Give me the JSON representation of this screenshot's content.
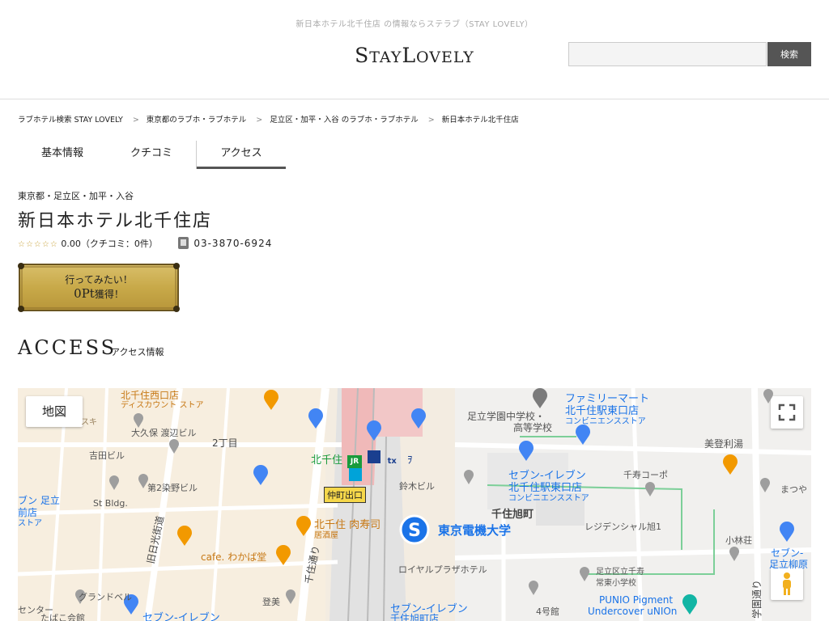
{
  "header": {
    "tagline": "新日本ホテル北千住店 の情報ならステラブ（STAY LOVELY）",
    "logo": "StayLovely",
    "search_placeholder": "",
    "search_button": "検索"
  },
  "breadcrumb": [
    "ラブホテル検索 STAY LOVELY",
    "東京都のラブホ・ラブホテル",
    "足立区・加平・入谷 のラブホ・ラブホテル",
    "新日本ホテル北千住店"
  ],
  "tabs": [
    {
      "label": "基本情報"
    },
    {
      "label": "クチコミ"
    },
    {
      "label": "アクセス"
    }
  ],
  "hotel": {
    "region": "東京都・足立区・加平・入谷",
    "name": "新日本ホテル北千住店",
    "stars": "☆☆☆☆☆",
    "rating_text": "0.00（クチコミ：0件）",
    "phone": "03-3870-6924"
  },
  "badge": {
    "line1": "行ってみたい！",
    "points": "0Pt",
    "line2": "獲得！"
  },
  "access": {
    "title": "ACCESS",
    "subtitle": "アクセス情報"
  },
  "map": {
    "map_type_button": "地図",
    "labels": {
      "kitasenju_nishiguchi": "北千住西口店",
      "discount_store": "ディスカウント ストア",
      "ookubo": "大久保 渡辺ビル",
      "nichome": "2丁目",
      "yoshida": "吉田ビル",
      "daini_someno": "第2染野ビル",
      "st_bldg": "St Bldg.",
      "adachi_partial": "ブン 足立",
      "maeten": "前店",
      "store_partial": "ストア",
      "kitasenju_station": "北千住",
      "nakamachi_exit": "仲町出口",
      "suzuki_bldg": "鈴木ビル",
      "senju_asahicho": "千住旭町",
      "denki_univ": "東京電機大学",
      "royal_plaza": "ロイヤルプラザホテル",
      "family_mart": "ファミリーマート",
      "family_mart2": "北千住駅東口店",
      "convenience": "コンビニエンスストア",
      "adachi_gakuen": "足立学園中学校・",
      "koto_gakko": "高等学校",
      "seven_eleven": "セブン-イレブン",
      "seven_kita_east": "北千住駅東口店",
      "convenience2": "コンビニエンスストア",
      "bitoyu": "美登利湯",
      "senju_kobo": "千寿コーポ",
      "matsuya": "まつや",
      "residential": "レジデンシャル旭1",
      "kobayashi": "小林荘",
      "seven_right": "セブン-",
      "adachi_yanagi": "足立柳原",
      "adachi_senju": "足立区立千寿",
      "joto_elem": "常東小学校",
      "punio": "PUNIO Pigment",
      "undercover": "Undercover uNIOn",
      "kitasenju_nikusushi": "北千住 肉寿司",
      "izakaya": "居酒屋",
      "cafe": "cafe. わかば堂",
      "grandbell": "グランドベル",
      "tobi": "登美",
      "senju_dori": "千住通り",
      "kyunikko": "旧日光街道",
      "center": "センター",
      "tabako": "たばこ会館",
      "seven_bottom": "セブン-イレブン",
      "seven_bottom2": "千住旭町店",
      "yonkan": "4号館",
      "gakuen_dori": "学園通り",
      "suki": "スキ"
    }
  }
}
